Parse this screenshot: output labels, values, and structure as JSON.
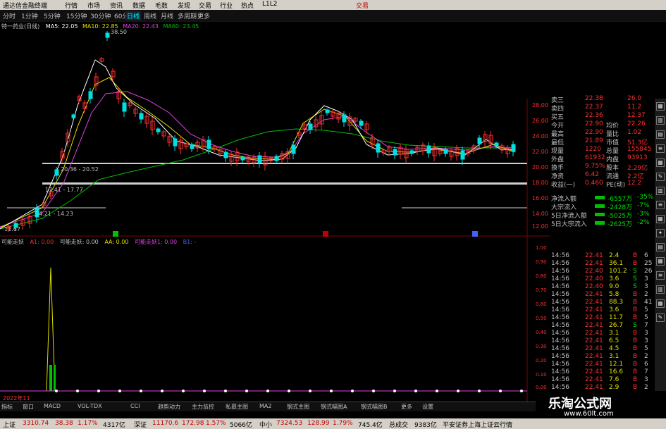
{
  "menu": {
    "app_title": "通达信金融终端",
    "items": [
      "行情",
      "市场",
      "资讯",
      "数据",
      "毛数",
      "发现",
      "交易",
      "行业",
      "热点",
      "L1L2"
    ],
    "right_label": "交易"
  },
  "periods": {
    "items": [
      "分时",
      "1分钟",
      "5分钟",
      "15分钟",
      "30分钟",
      "60分钟",
      "日线",
      "周线",
      "月线",
      "多周期",
      "更多"
    ],
    "active_index": 6
  },
  "chart_header": {
    "stock": "特一药业(日线)",
    "ma5": "MA5: 22.05",
    "ma10": "MA10: 22.85",
    "ma20": "MA20: 22.43",
    "ma60": "MA60: 23.45"
  },
  "price_axis": {
    "ticks": [
      "28.00",
      "26.00",
      "24.00",
      "22.00",
      "20.00",
      "18.00",
      "16.00",
      "14.00",
      "12.00"
    ]
  },
  "annotations": {
    "high": "38.50",
    "low": "11.67",
    "band1": "20.36 - 20.52",
    "band2": "17.41 - 17.77",
    "band3": "14.21 - 14.23"
  },
  "lower_header": {
    "name": "可能走妖",
    "a1": "A1: 0.00",
    "name2": "可能走妖: 0.00",
    "aa": "AA: 0.00",
    "name3": "可能走妖1: 0.00",
    "b1": "B1: -"
  },
  "lower_axis": {
    "ticks": [
      "1.00",
      "0.90",
      "0.80",
      "0.70",
      "0.60",
      "0.50",
      "0.40",
      "0.30",
      "0.20",
      "0.10",
      "0.00"
    ]
  },
  "date_label": "2022年11",
  "quote": {
    "rows": [
      {
        "label": "卖三",
        "v1": "22.38",
        "v2": "26.0"
      },
      {
        "label": "卖四",
        "v1": "22.37",
        "v2": "11.2"
      },
      {
        "label": "买五",
        "v1": "22.36",
        "v2": "12.37"
      },
      {
        "label": "今开",
        "v1": "22.90",
        "label2": "均价",
        "v2": "22.26"
      },
      {
        "label": "最高",
        "v1": "22.90",
        "label2": "量比",
        "v2": "1.02"
      },
      {
        "label": "最低",
        "v1": "21.89",
        "label2": "市值",
        "v2": "51.3亿"
      },
      {
        "label": "现量",
        "v1": "1220",
        "label2": "总量",
        "v2": "155845"
      },
      {
        "label": "外盘",
        "v1": "61932",
        "label2": "内盘",
        "v2": "93913"
      },
      {
        "label": "换手",
        "v1": "9.75%",
        "label2": "股本",
        "v2": "2.29亿"
      },
      {
        "label": "净资",
        "v1": "6.42",
        "label2": "流通",
        "v2": "2.2亿"
      },
      {
        "label": "收益(一)",
        "v1": "0.460",
        "label2": "PE(动)",
        "v2": "12.2"
      }
    ],
    "flows": [
      {
        "label": "净流入额",
        "v": "-6557万",
        "p": "-35%"
      },
      {
        "label": "大宗流入",
        "v": "-2428万",
        "p": "-7%"
      },
      {
        "label": "5日净流入额",
        "v": "-5025万",
        "p": "-3%"
      },
      {
        "label": "5日大宗流入",
        "v": "-2625万",
        "p": "-2%"
      }
    ]
  },
  "ticks": [
    {
      "t": "14:56",
      "p": "22.41",
      "v": "2.4",
      "s": "B",
      "n": "6"
    },
    {
      "t": "14:56",
      "p": "22.41",
      "v": "36.1",
      "s": "B",
      "n": "25"
    },
    {
      "t": "14:56",
      "p": "22.40",
      "v": "101.2",
      "s": "S",
      "n": "26"
    },
    {
      "t": "14:56",
      "p": "22.40",
      "v": "3.6",
      "s": "S",
      "n": "3"
    },
    {
      "t": "14:56",
      "p": "22.40",
      "v": "9.0",
      "s": "S",
      "n": "3"
    },
    {
      "t": "14:56",
      "p": "22.41",
      "v": "5.8",
      "s": "B",
      "n": "2"
    },
    {
      "t": "14:56",
      "p": "22.41",
      "v": "88.3",
      "s": "B",
      "n": "41"
    },
    {
      "t": "14:56",
      "p": "22.41",
      "v": "3.6",
      "s": "B",
      "n": "5"
    },
    {
      "t": "14:56",
      "p": "22.41",
      "v": "11.7",
      "s": "B",
      "n": "5"
    },
    {
      "t": "14:56",
      "p": "22.41",
      "v": "26.7",
      "s": "S",
      "n": "7"
    },
    {
      "t": "14:56",
      "p": "22.41",
      "v": "3.1",
      "s": "B",
      "n": "3"
    },
    {
      "t": "14:56",
      "p": "22.41",
      "v": "6.5",
      "s": "B",
      "n": "3"
    },
    {
      "t": "14:56",
      "p": "22.41",
      "v": "4.5",
      "s": "B",
      "n": "5"
    },
    {
      "t": "14:56",
      "p": "22.41",
      "v": "3.1",
      "s": "B",
      "n": "2"
    },
    {
      "t": "14:56",
      "p": "22.41",
      "v": "12.1",
      "s": "B",
      "n": "6"
    },
    {
      "t": "14:56",
      "p": "22.41",
      "v": "16.6",
      "s": "B",
      "n": "7"
    },
    {
      "t": "14:56",
      "p": "22.41",
      "v": "7.6",
      "s": "B",
      "n": "3"
    },
    {
      "t": "14:56",
      "p": "22.41",
      "v": "2.9",
      "s": "B",
      "n": "2"
    }
  ],
  "tabs": [
    "指标",
    "窗口",
    "MACD",
    "VOL-TDX",
    "CCI",
    "趋势动力",
    "主力监控",
    "私募主图",
    "MA2",
    "钢式主图",
    "钢式幅图A",
    "钢式幅图B",
    "更多",
    "设置"
  ],
  "status": {
    "sh": "上证",
    "sh_v": "3310.74",
    "sh_c": "38.38",
    "sh_p": "1.17%",
    "sh_amt": "4317亿",
    "sz": "深证",
    "sz_v": "11170.6",
    "sz_c": "172.98",
    "sz_p": "1.57%",
    "sz_amt": "5066亿",
    "zx": "中小",
    "zx_v": "7324.53",
    "zx_c": "128.99",
    "zx_p": "1.79%",
    "zx_amt": "745.4亿",
    "total": "总成交",
    "total_v": "9383亿",
    "broker": "平安证券上海上证云行情"
  },
  "watermark": {
    "title": "乐淘公式网",
    "url": "www.60lt.com"
  },
  "colors": {
    "up": "#ff3030",
    "down": "#00e0e0",
    "ma5": "#ffffff",
    "ma10": "#e0e000",
    "ma20": "#e040e0",
    "ma60": "#00c000",
    "accent": "#ff0000"
  }
}
